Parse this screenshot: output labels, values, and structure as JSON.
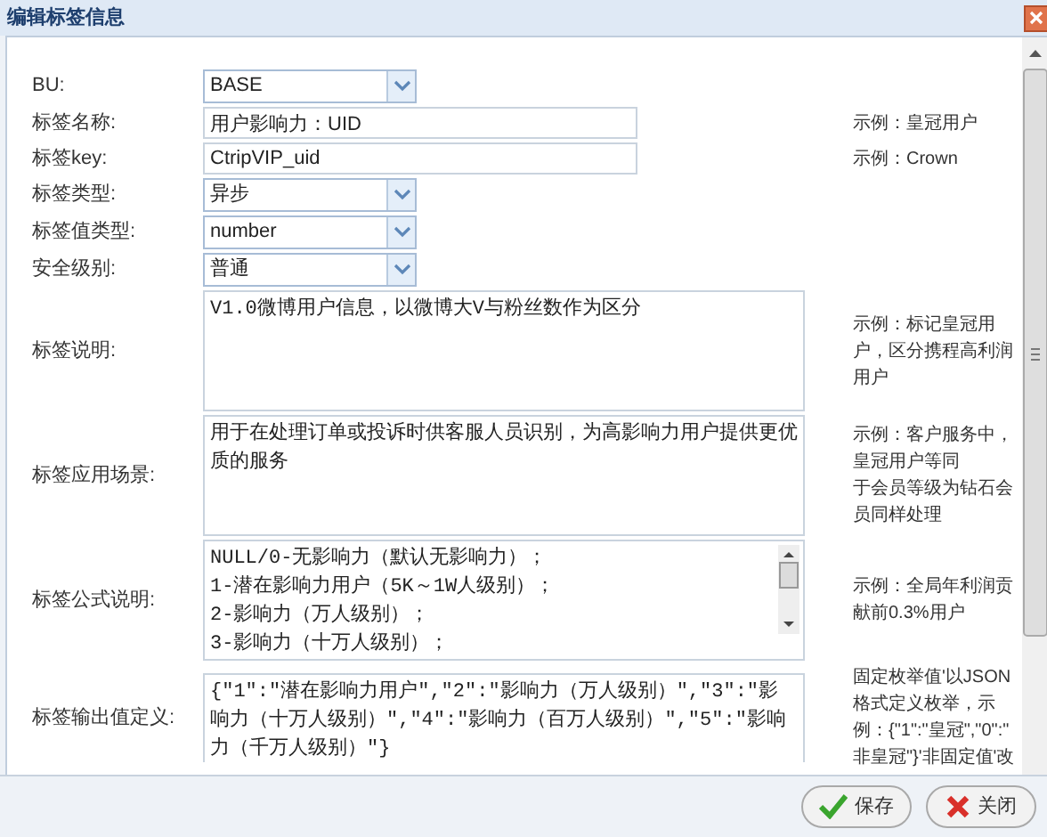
{
  "window": {
    "title": "编辑标签信息"
  },
  "fields": [
    {
      "kind": "select",
      "label": "BU:",
      "value": "BASE"
    },
    {
      "kind": "text",
      "label": "标签名称:",
      "value": "用户影响力：UID",
      "hint_lines": [
        "示例：皇冠用户"
      ]
    },
    {
      "kind": "text",
      "label": "标签key:",
      "value": "CtripVIP_uid",
      "hint_lines": [
        "示例：Crown"
      ]
    },
    {
      "kind": "select",
      "label": "标签类型:",
      "value": "异步"
    },
    {
      "kind": "select",
      "label": "标签值类型:",
      "value": "number"
    },
    {
      "kind": "select",
      "label": "安全级别:",
      "value": "普通"
    },
    {
      "kind": "textarea",
      "label": "标签说明:",
      "value": "V1.0微博用户信息，以微博大V与粉丝数作为区分",
      "hint_lines": [
        "示例：标记皇冠用",
        "户，区分携程高利润",
        "用户"
      ]
    },
    {
      "kind": "textarea",
      "label": "标签应用场景:",
      "value": "用于在处理订单或投诉时供客服人员识别，为高影响力用户提供更优质的服务",
      "hint_lines": [
        "示例：客户服务中，",
        "皇冠用户等同",
        "于会员等级为钻石会",
        "员同样处理"
      ]
    },
    {
      "kind": "scrolltext",
      "label": "标签公式说明:",
      "value": "NULL/0-无影响力（默认无影响力）；\n1-潜在影响力用户（5K～1W人级别）；\n2-影响力（万人级别）；\n3-影响力（十万人级别）；",
      "hint_lines": [
        "示例：全局年利润贡",
        "献前0.3%用户"
      ]
    },
    {
      "kind": "cuttext",
      "label": "标签输出值定义:",
      "value": "{\"1\":\"潜在影响力用户\",\"2\":\"影响力（万人级别）\",\"3\":\"影响力（十万人级别）\",\"4\":\"影响力（百万人级别）\",\"5\":\"影响力（千万人级别）\"}",
      "hint_lines": [
        "固定枚举值'以JSON",
        "格式定义枚举，示",
        "例：{\"1\":\"皇冠\",\"0\":\"",
        "非皇冠\"}'非固定值'改"
      ]
    }
  ],
  "buttons": [
    {
      "kind": "save",
      "label": "保存"
    },
    {
      "kind": "close",
      "label": "关闭"
    }
  ]
}
